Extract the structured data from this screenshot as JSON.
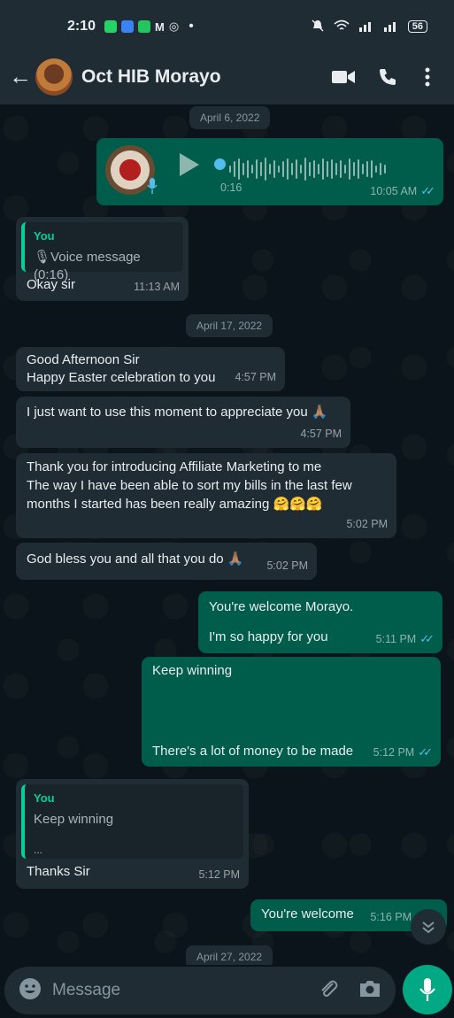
{
  "status_bar": {
    "time": "2:10",
    "dot": "•",
    "battery": "56"
  },
  "header": {
    "back_icon": "←",
    "contact_name": "Oct HIB Morayo"
  },
  "dates": {
    "d1": "April 6, 2022",
    "d2": "April 17, 2022",
    "d3": "April 27, 2022"
  },
  "messages": [
    {
      "duration": "0:16",
      "time": "10:05 AM"
    },
    {
      "quote_author": "You",
      "quote_text": "Voice message (0:16)",
      "text": "Okay sir",
      "time": "11:13 AM"
    },
    {
      "line1": "Good Afternoon Sir",
      "line2": "Happy Easter celebration to you",
      "time": "4:57 PM"
    },
    {
      "text": "I just want to use this moment to appreciate you 🙏🏽",
      "time": "4:57 PM"
    },
    {
      "line1": "Thank you for introducing Affiliate Marketing to me",
      "line2": "The way I have been able to sort my bills in the last few",
      "line3": "months I started has been really amazing 🤗🤗🤗",
      "time": "5:02 PM"
    },
    {
      "text": "God bless you and all that you do 🙏🏽",
      "time": "5:02 PM"
    },
    {
      "line1": "You're welcome Morayo.",
      "line2": "I'm so happy for you",
      "time": "5:11 PM"
    },
    {
      "line1": "Keep winning",
      "line2": "There's a lot of money to be made",
      "time": "5:12 PM"
    },
    {
      "quote_author": "You",
      "quote_text": "Keep winning",
      "quote_extra": "...",
      "text": "Thanks Sir",
      "time": "5:12 PM"
    },
    {
      "text": "You're welcome",
      "time": "5:16 PM"
    }
  ],
  "composer": {
    "placeholder": "Message"
  },
  "icons": {
    "back": "arrow-left-icon",
    "video": "video-camera-icon",
    "call": "phone-icon",
    "menu": "more-vert-icon",
    "play": "play-icon",
    "mic": "mic-icon",
    "emoji": "emoji-icon",
    "attach": "paperclip-icon",
    "camera": "camera-icon",
    "scroll": "chevron-double-down-icon"
  },
  "colors": {
    "incoming": "#1f2c34",
    "outgoing": "#005c4b",
    "accent": "#00a884",
    "read_ticks": "#53bdeb"
  }
}
